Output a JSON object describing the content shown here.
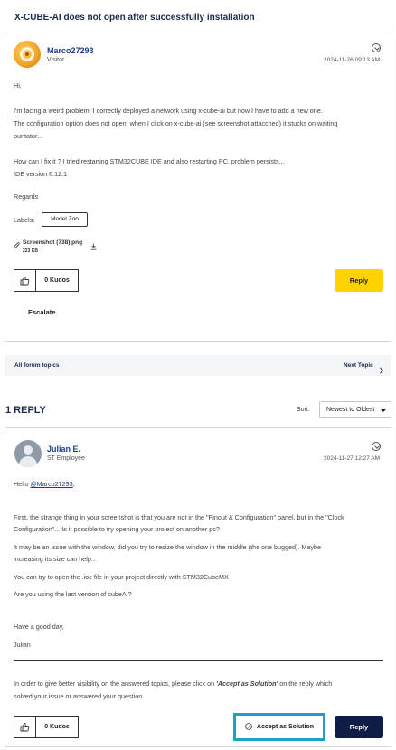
{
  "topic": {
    "title": "X-CUBE-AI does not open after successfully installation"
  },
  "post": {
    "author": "Marco27293",
    "rank": "Visitor",
    "date": "2024-11-26 09:13 AM",
    "lines": [
      "Hi,",
      "I'm facing a weird problem: I correctly deployed a network using x-cube-ai but now I have to add a new one.",
      "The configuration option does not open, when I click on x-cube-ai (see screenshot attacched) it stucks on waiting",
      "puntator...",
      "How  can I fix it ? I tried restarting STM32CUBE IDE and also restarting PC, problem persists...",
      "IDE version 6.12.1",
      "Regards"
    ],
    "labels_caption": "Labels:",
    "label_chip": "Model Zoo",
    "attachment_name": "Screenshot (738).png",
    "attachment_size": "223 KB",
    "kudos": "0 Kudos",
    "reply_button": "Reply",
    "escalate": "Escalate"
  },
  "nav": {
    "all_topics": "All forum topics",
    "next_topic": "Next Topic"
  },
  "replies": {
    "count_label": "1 REPLY",
    "sort_label": "Sort:",
    "sort_value": "Newest to Oldest"
  },
  "reply": {
    "author": "Julian E.",
    "rank": "ST Employee",
    "date": "2024-11-27 12:27 AM",
    "greeting": "Hello ",
    "mention": "@Marco27293",
    "greeting_end": ",",
    "lines": [
      "First, the strange thing in your screenshot is that you are not in the \"Pinout & Configuration\" panel, but in the \"Clock",
      "Configuration\"... Is it possible to try opening your project on another pc?",
      "It may be an issue with the window, did you try to resize the window in the middle (the one bugged). Maybe",
      "increasing its size can help...",
      "You can try to open the .ioc file in your project directly with STM32CubeMX",
      "Are you using the last version of cubeAI?",
      "Have a good day,",
      "Julian"
    ],
    "footer_a": "In order to give better visibility on the answered topics, please click on ",
    "footer_b": "'Accept as Solution'",
    "footer_c": " on the reply which",
    "footer_d": "solved your issue or answered your question.",
    "kudos": "0 Kudos",
    "accept_button": "Accept as Solution",
    "reply_button": "Reply"
  },
  "colors": {
    "accent_yellow": "#ffd200",
    "navy": "#0d1d48",
    "link_blue": "#1a3f8f",
    "accept_border": "#1ba3c4"
  },
  "icons": [
    "avatar-orange-icon",
    "chevron-down-circle-icon",
    "paperclip-icon",
    "download-icon",
    "thumbs-up-icon",
    "chevron-right-icon",
    "checkmark-circle-icon",
    "user-avatar-icon"
  ]
}
